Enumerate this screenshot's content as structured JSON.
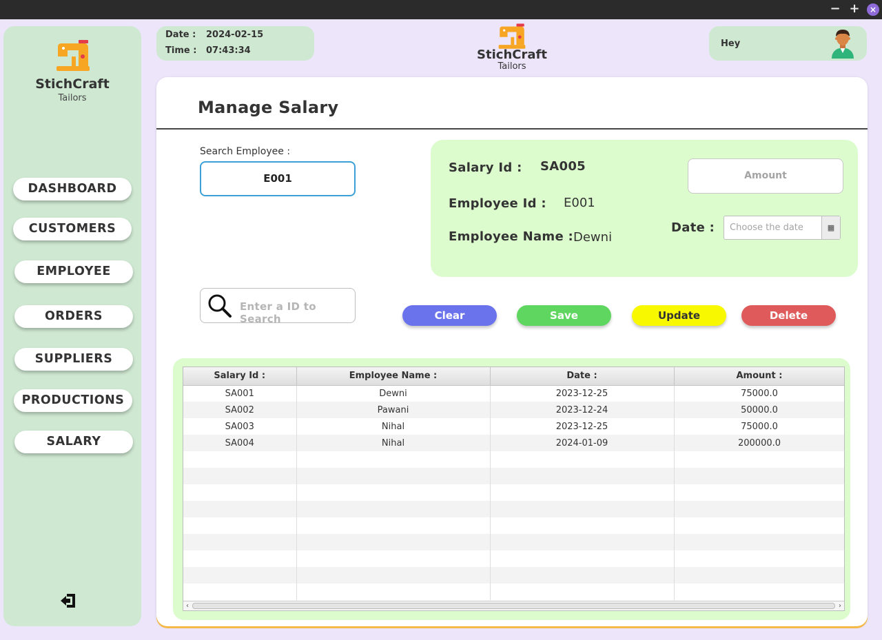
{
  "colors": {
    "background": "#ede6fb",
    "panel_green": "#cfe8d2",
    "form_green": "#dcfccd",
    "accent_orange": "#f5b94a"
  },
  "window": {
    "minimize_icon": "−",
    "maximize_icon": "+",
    "close_icon": "×"
  },
  "brand": {
    "name": "StichCraft",
    "subtitle": "Tailors",
    "logo_icon": "sewing-machine-icon"
  },
  "sidebar": {
    "items": [
      {
        "label": "DASHBOARD"
      },
      {
        "label": "CUSTOMERS"
      },
      {
        "label": "EMPLOYEE"
      },
      {
        "label": "ORDERS"
      },
      {
        "label": "SUPPLIERS"
      },
      {
        "label": "PRODUCTIONS"
      },
      {
        "label": "SALARY"
      }
    ],
    "logout_icon": "logout-icon"
  },
  "datetime": {
    "date_label": "Date :",
    "date_value": "2024-02-15",
    "time_label": "Time :",
    "time_value": "07:43:34"
  },
  "user": {
    "greeting": "Hey",
    "avatar_icon": "user-avatar-icon"
  },
  "page": {
    "title": "Manage Salary"
  },
  "search_employee": {
    "label": "Search Employee :",
    "value": "E001"
  },
  "salary_form": {
    "salary_id_label": "Salary Id :",
    "salary_id_value": "SA005",
    "employee_id_label": "Employee Id :",
    "employee_id_value": "E001",
    "employee_name_label": "Employee Name :",
    "employee_name_value": "Dewni",
    "amount_placeholder": "Amount",
    "date_label": "Date :",
    "date_placeholder": "Choose the date",
    "calendar_icon": "calendar-icon"
  },
  "id_search": {
    "placeholder": "Enter a ID to Search",
    "icon": "search-icon"
  },
  "actions": {
    "clear": {
      "label": "Clear",
      "color": "#6b73ec"
    },
    "save": {
      "label": "Save",
      "color": "#5fd65f"
    },
    "update": {
      "label": "Update",
      "color": "#f8f800"
    },
    "delete": {
      "label": "Delete",
      "color": "#df5b5b"
    }
  },
  "table": {
    "columns": [
      "Salary Id :",
      "Employee Name :",
      "Date :",
      "Amount :"
    ],
    "rows": [
      [
        "SA001",
        "Dewni",
        "2023-12-25",
        "75000.0"
      ],
      [
        "SA002",
        "Pawani",
        "2023-12-24",
        "50000.0"
      ],
      [
        "SA003",
        "Nihal",
        "2023-12-25",
        "75000.0"
      ],
      [
        "SA004",
        "Nihal",
        "2024-01-09",
        "200000.0"
      ]
    ]
  }
}
